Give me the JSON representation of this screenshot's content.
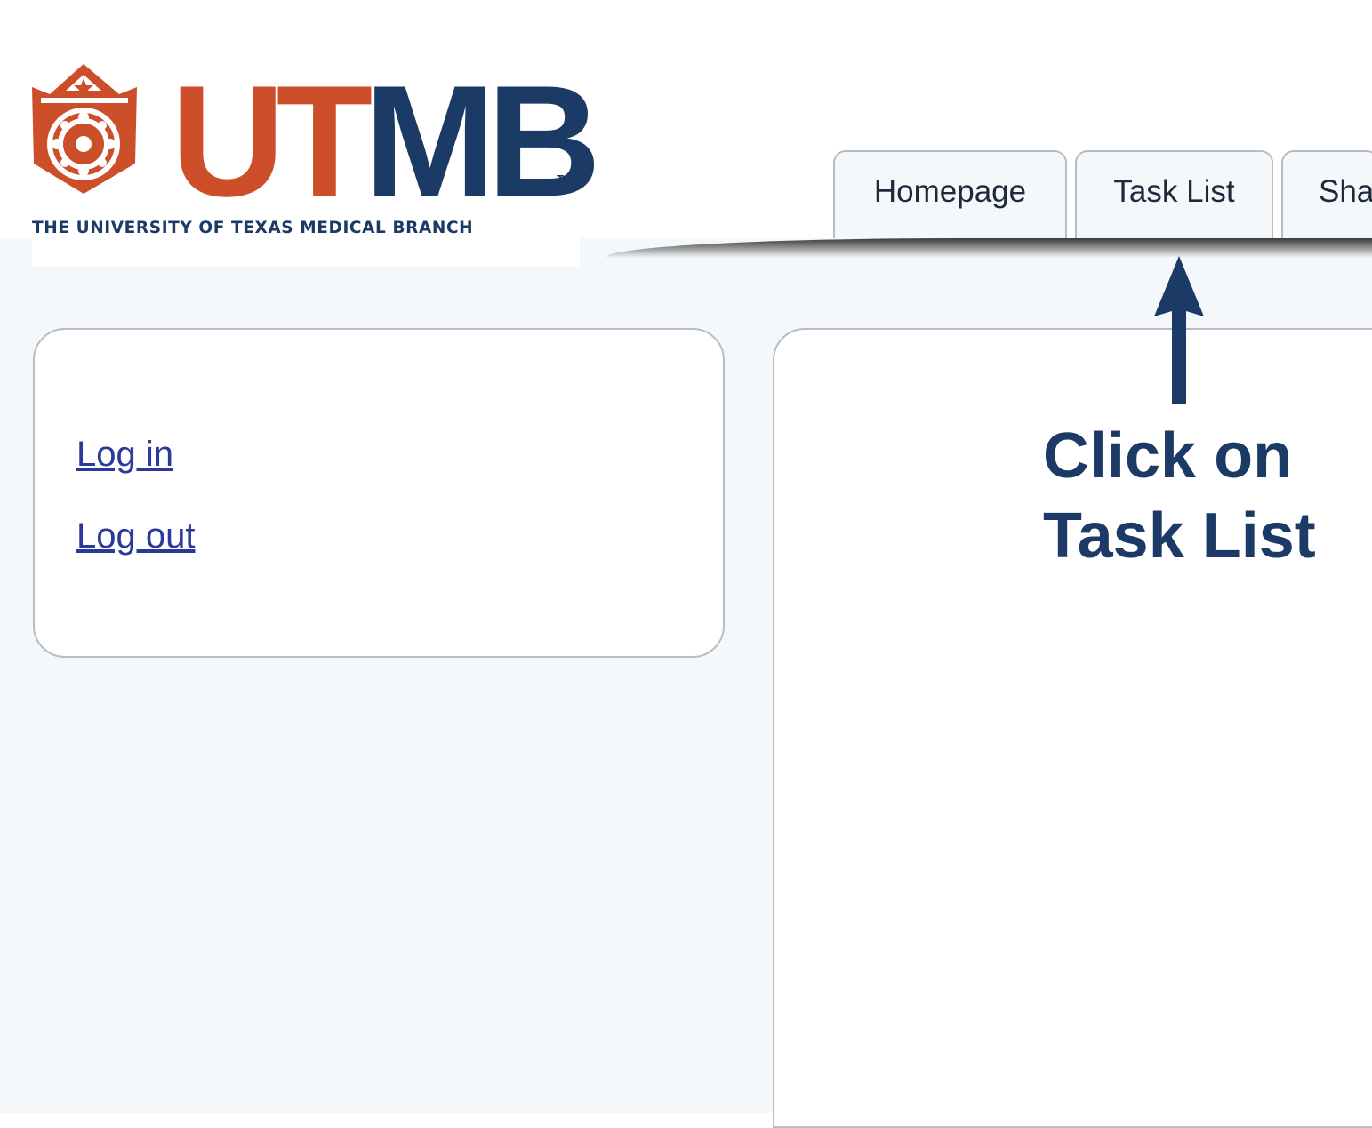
{
  "logo": {
    "word_ut": "UT",
    "word_mb": "MB",
    "trademark": "TM",
    "tagline": "THE UNIVERSITY OF TEXAS MEDICAL BRANCH",
    "colors": {
      "orange": "#cc4f2a",
      "navy": "#1b3a66"
    }
  },
  "tabs": [
    {
      "label": "Homepage"
    },
    {
      "label": "Task List"
    },
    {
      "label": "Sha"
    }
  ],
  "sidebar": {
    "links": [
      {
        "label": "Log in"
      },
      {
        "label": "Log out"
      }
    ]
  },
  "annotation": {
    "line1": "Click on",
    "line2": "Task List",
    "icon": "up-arrow-icon",
    "color": "#1b3a66"
  }
}
